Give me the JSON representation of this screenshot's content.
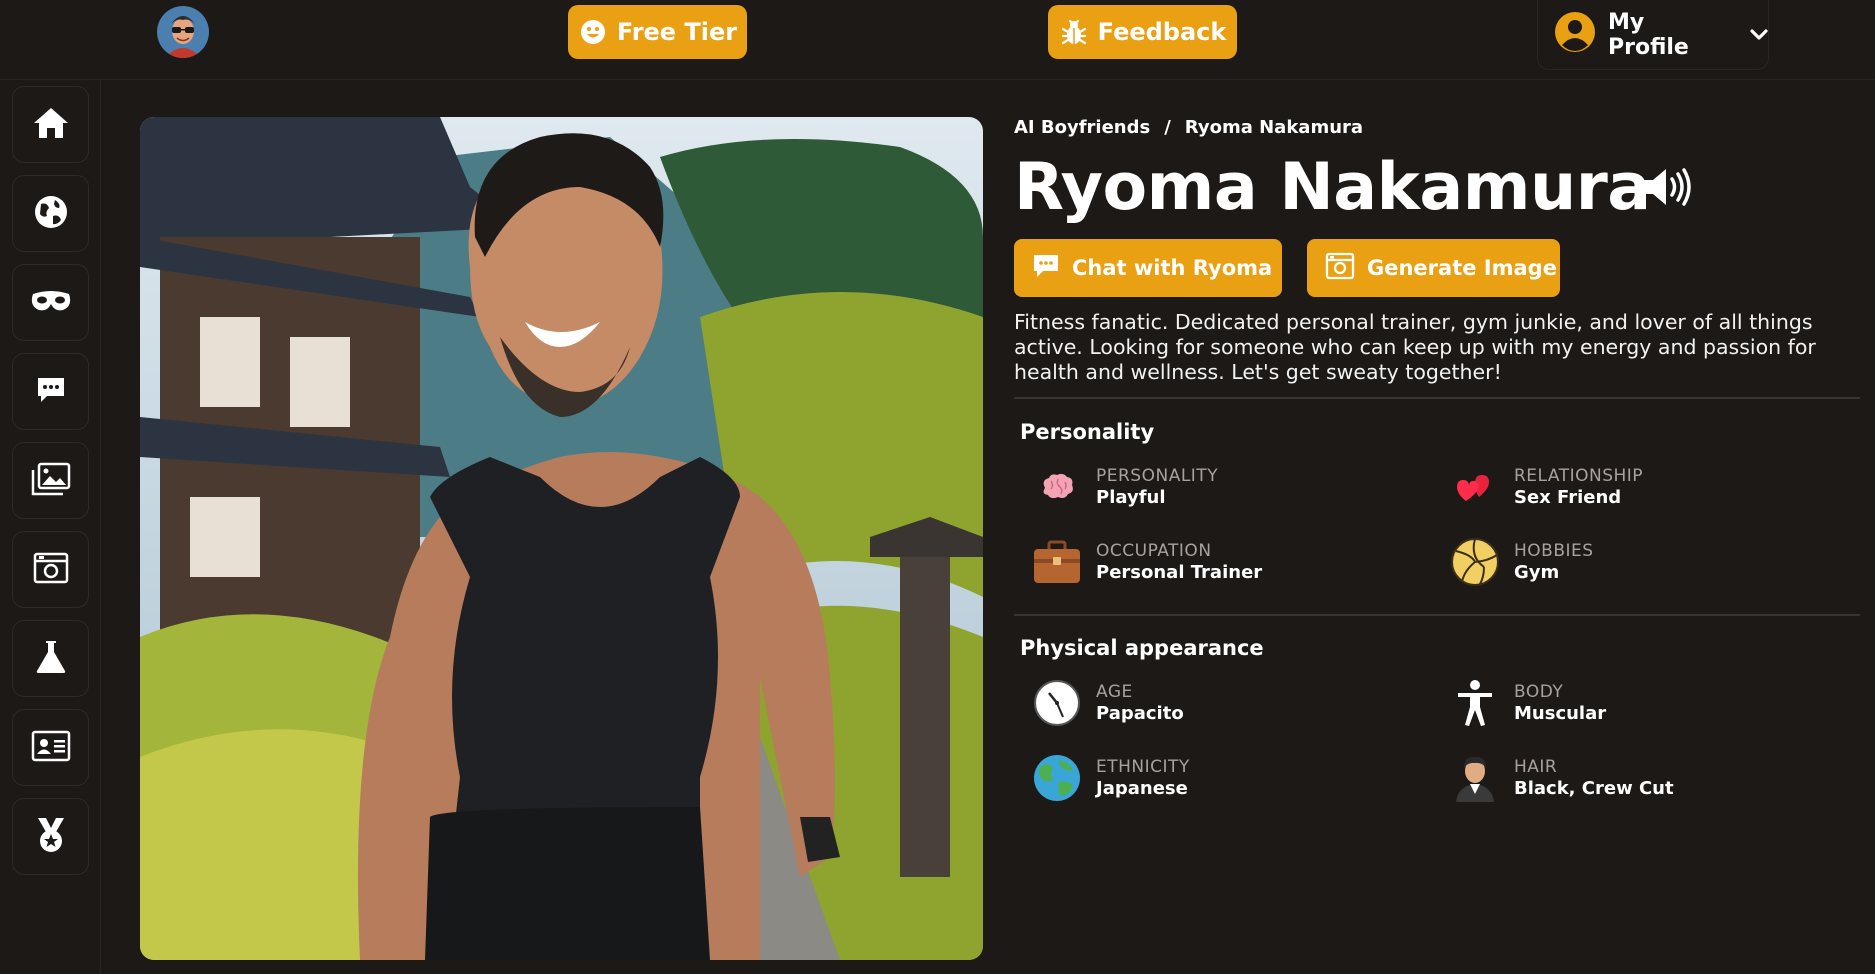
{
  "header": {
    "free_tier_label": "Free Tier",
    "feedback_label": "Feedback",
    "profile_label": "My Profile"
  },
  "sidebar": {
    "items": [
      {
        "icon": "home-icon"
      },
      {
        "icon": "globe-icon"
      },
      {
        "icon": "mask-icon"
      },
      {
        "icon": "chat-icon"
      },
      {
        "icon": "gallery-icon"
      },
      {
        "icon": "camera-icon"
      },
      {
        "icon": "flask-icon"
      },
      {
        "icon": "id-card-icon"
      },
      {
        "icon": "medal-icon"
      }
    ]
  },
  "breadcrumb": {
    "parent": "AI Boyfriends",
    "separator": "/",
    "current": "Ryoma Nakamura"
  },
  "character": {
    "name": "Ryoma Nakamura",
    "chat_button": "Chat with Ryoma",
    "generate_button": "Generate Image",
    "description": "Fitness fanatic. Dedicated personal trainer, gym junkie, and lover of all things active. Looking for someone who can keep up with my energy and passion for health and wellness. Let's get sweaty together!"
  },
  "personality": {
    "title": "Personality",
    "personality_label": "PERSONALITY",
    "personality_value": "Playful",
    "relationship_label": "RELATIONSHIP",
    "relationship_value": "Sex Friend",
    "occupation_label": "OCCUPATION",
    "occupation_value": "Personal Trainer",
    "hobbies_label": "HOBBIES",
    "hobbies_value": "Gym"
  },
  "physical": {
    "title": "Physical appearance",
    "age_label": "AGE",
    "age_value": "Papacito",
    "body_label": "BODY",
    "body_value": "Muscular",
    "ethnicity_label": "ETHNICITY",
    "ethnicity_value": "Japanese",
    "hair_label": "HAIR",
    "hair_value": "Black, Crew Cut"
  },
  "colors": {
    "accent": "#e9a013",
    "background": "#1c1917",
    "muted_text": "#a8a29e"
  }
}
